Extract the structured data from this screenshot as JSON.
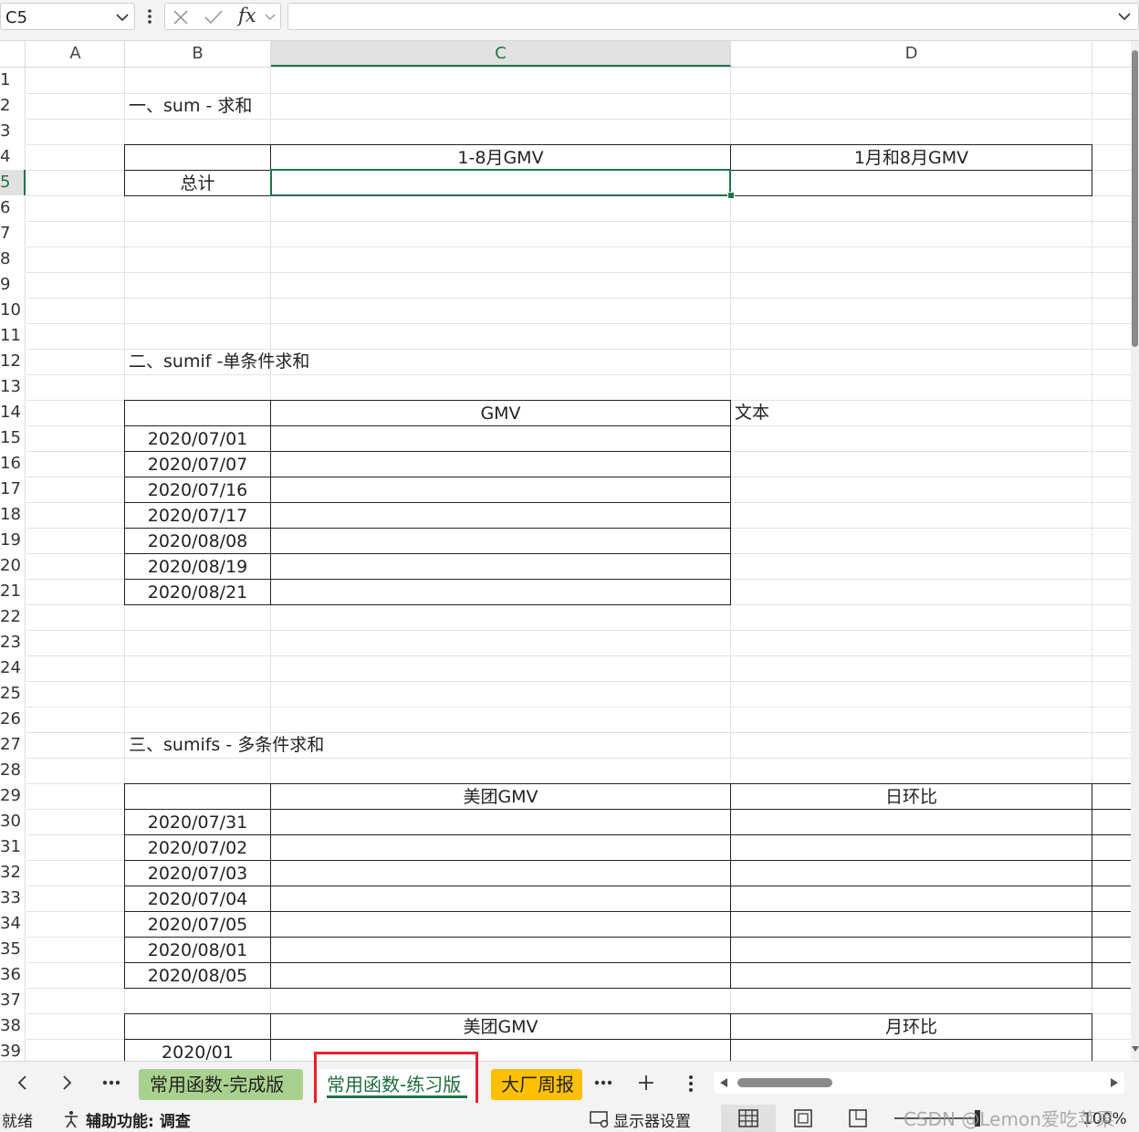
{
  "formula_bar": {
    "name_box": "C5",
    "fx_label": "fx",
    "formula_value": ""
  },
  "columns": [
    {
      "label": "A"
    },
    {
      "label": "B"
    },
    {
      "label": "C"
    },
    {
      "label": "D"
    }
  ],
  "rows": [
    "1",
    "2",
    "3",
    "4",
    "5",
    "6",
    "7",
    "8",
    "9",
    "10",
    "11",
    "12",
    "13",
    "14",
    "15",
    "16",
    "17",
    "18",
    "19",
    "20",
    "21",
    "22",
    "23",
    "24",
    "25",
    "26",
    "27",
    "28",
    "29",
    "30",
    "31",
    "32",
    "33",
    "34",
    "35",
    "36",
    "37",
    "38",
    "39"
  ],
  "sheet": {
    "sec1_title": "一、sum - 求和",
    "sec1_h_c": "1-8月GMV",
    "sec1_h_d": "1月和8月GMV",
    "sec1_total": "总计",
    "sec2_title": "二、sumif -单条件求和",
    "sec2_h_c": "GMV",
    "sec2_note": "文本",
    "sec2_dates": [
      "2020/07/01",
      "2020/07/07",
      "2020/07/16",
      "2020/07/17",
      "2020/08/08",
      "2020/08/19",
      "2020/08/21"
    ],
    "sec3_title": "三、sumifs - 多条件求和",
    "sec3_h_c": "美团GMV",
    "sec3_h_d": "日环比",
    "sec3_dates": [
      "2020/07/31",
      "2020/07/02",
      "2020/07/03",
      "2020/07/04",
      "2020/07/05",
      "2020/08/01",
      "2020/08/05"
    ],
    "sec4_h_c": "美团GMV",
    "sec4_h_d": "月环比",
    "sec4_first": "2020/01"
  },
  "tabs": [
    {
      "label": "常用函数-完成版",
      "color": "#a9d18e"
    },
    {
      "label": "常用函数-练习版",
      "active": true
    },
    {
      "label": "大厂周报",
      "color": "#ffc000"
    }
  ],
  "status": {
    "ready": "就绪",
    "accessibility": "辅助功能: 调查",
    "display_settings": "显示器设置",
    "zoom": "100%",
    "watermark": "CSDN @Lemon爱吃苹果"
  },
  "colors": {
    "accent_green": "#217346",
    "highlight_red": "#e8202a"
  }
}
